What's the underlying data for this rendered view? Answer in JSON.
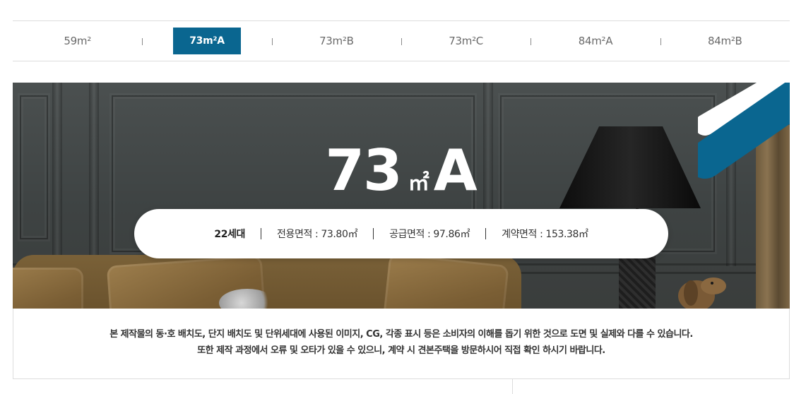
{
  "tabs": [
    {
      "label": "59m²",
      "active": false
    },
    {
      "label": "73m²A",
      "active": true
    },
    {
      "label": "73m²B",
      "active": false
    },
    {
      "label": "73m²C",
      "active": false
    },
    {
      "label": "84m²A",
      "active": false
    },
    {
      "label": "84m²B",
      "active": false
    }
  ],
  "hero": {
    "title_number": "73",
    "title_unit": "㎡",
    "title_letter": "A",
    "info": {
      "households": "22세대",
      "exclusive_area": "전용면적 : 73.80㎡",
      "supply_area": "공급면적 : 97.86㎡",
      "contract_area": "계약면적 : 153.38㎡"
    }
  },
  "notice": {
    "line1": "본 제작물의 동·호 배치도, 단지 배치도 및 단위세대에 사용된 이미지, CG, 각종 표시 등은 소비자의 이해를 돕기 위한 것으로 도면 및 실제와 다를 수 있습니다.",
    "line2": "또한 제작 과정에서 오류 및 오타가 있을 수 있으니, 계약 시 견본주택을 방문하시어 직접 확인 하시기 바랍니다."
  },
  "colors": {
    "accent": "#0a6690",
    "tab_text": "#6a6a6a",
    "border": "#dcdcdc"
  }
}
